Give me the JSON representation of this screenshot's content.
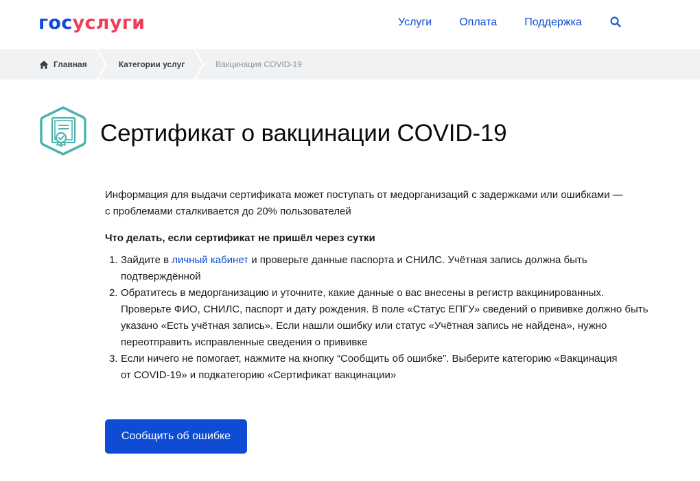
{
  "header": {
    "logo_part1": "гос",
    "logo_part2": "услуги",
    "nav": {
      "uslugi": "Услуги",
      "oplata": "Оплата",
      "podderzhka": "Поддержка"
    }
  },
  "breadcrumbs": {
    "home": "Главная",
    "category": "Категории услуг",
    "current": "Вакцинация COVID-19"
  },
  "page": {
    "title": "Сертификат о вакцинации COVID-19",
    "intro_line1": "Информация для выдачи сертификата может поступать от медорганизаций с задержками или ошибками —",
    "intro_line2": "с проблемами сталкивается до 20% пользователей",
    "subheading": "Что делать, если сертификат не пришёл через сутки",
    "steps": [
      {
        "num": "1.",
        "before_link": "Зайдите в ",
        "link": "личный кабинет",
        "after_link_line1": " и проверьте данные паспорта и СНИЛС. Учётная запись должна быть",
        "line2": "подтверждённой"
      },
      {
        "num": "2.",
        "line1": "Обратитесь в медорганизацию и уточните, какие данные о вас внесены в регистр вакцинированных.",
        "line2": "Проверьте ФИО, СНИЛС, паспорт и дату рождения. В поле «Статус ЕПГУ» сведений о прививке должно быть",
        "line3": "указано «Есть учётная запись». Если нашли ошибку или статус «Учётная запись не найдена», нужно",
        "line4": "переотправить исправленные сведения о прививке"
      },
      {
        "num": "3.",
        "line1": "Если ничего не помогает, нажмите на кнопку “Сообщить об ошибке”. Выберите категорию «Вакцинация",
        "line2": "от COVID-19» и подкатегорию «Сертификат вакцинации»"
      }
    ],
    "button_label": "Сообщить об ошибке"
  },
  "colors": {
    "brand_blue": "#0d4cd3",
    "brand_red": "#ee3f58",
    "icon_teal": "#4db3b0",
    "breadcrumb_bg": "#f1f2f3"
  },
  "icons": [
    "home-icon",
    "search-icon",
    "certificate-icon"
  ]
}
